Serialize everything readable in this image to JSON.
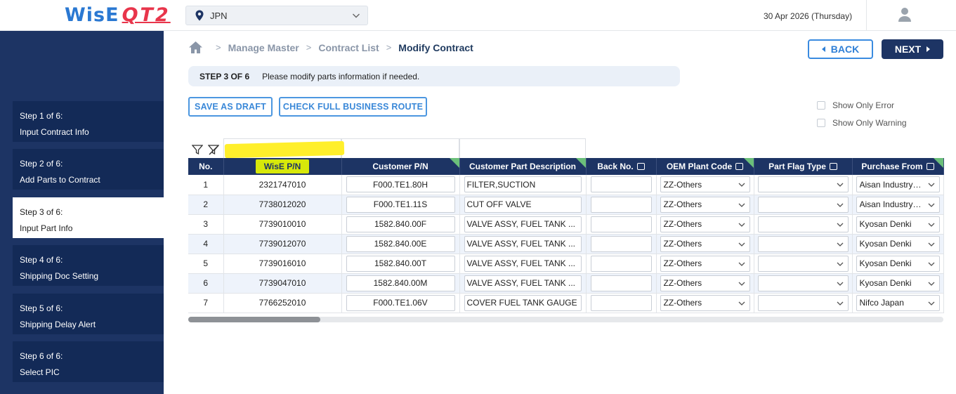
{
  "header": {
    "logo_main": "WisE",
    "logo_sub": "QT2",
    "country": "JPN",
    "date": "30 Apr 2026 (Thursday)"
  },
  "sidebar": {
    "steps": [
      {
        "num": "Step 1 of 6:",
        "label": "Input Contract Info"
      },
      {
        "num": "Step 2 of 6:",
        "label": "Add Parts to Contract"
      },
      {
        "num": "Step 3 of 6:",
        "label": "Input Part Info"
      },
      {
        "num": "Step 4 of 6:",
        "label": "Shipping Doc Setting"
      },
      {
        "num": "Step 5 of 6:",
        "label": "Shipping Delay Alert"
      },
      {
        "num": "Step 6 of 6:",
        "label": "Select PIC"
      }
    ],
    "active_index": 2
  },
  "breadcrumb": {
    "items": [
      "Manage Master",
      "Contract List",
      "Modify Contract"
    ]
  },
  "actions": {
    "back_label": "BACK",
    "next_label": "NEXT",
    "save_draft_label": "SAVE AS DRAFT",
    "check_route_label": "CHECK FULL BUSINESS ROUTE"
  },
  "stepbar": {
    "step": "STEP 3 OF 6",
    "message": "Please modify parts information if needed."
  },
  "filters_panel": {
    "show_only_error": "Show Only Error",
    "show_only_warning": "Show Only Warning"
  },
  "table": {
    "columns": {
      "no": "No.",
      "wise_pn": "WisE P/N",
      "customer_pn": "Customer P/N",
      "customer_desc": "Customer Part Description",
      "back_no": "Back No.",
      "oem_plant": "OEM Plant Code",
      "part_flag": "Part Flag Type",
      "purchase_from": "Purchase From"
    },
    "rows": [
      {
        "no": "1",
        "wise_pn": "2321747010",
        "customer_pn": "F000.TE1.80H",
        "desc": "FILTER,SUCTION",
        "back_no": "",
        "oem": "ZZ-Others",
        "flag": "",
        "purchase": "Aisan Industry Japan"
      },
      {
        "no": "2",
        "wise_pn": "7738012020",
        "customer_pn": "F000.TE1.11S",
        "desc": "CUT OFF VALVE",
        "back_no": "",
        "oem": "ZZ-Others",
        "flag": "",
        "purchase": "Aisan Industry Japan"
      },
      {
        "no": "3",
        "wise_pn": "7739010010",
        "customer_pn": "1582.840.00F",
        "desc": "VALVE ASSY, FUEL TANK ...",
        "back_no": "",
        "oem": "ZZ-Others",
        "flag": "",
        "purchase": "Kyosan Denki"
      },
      {
        "no": "4",
        "wise_pn": "7739012070",
        "customer_pn": "1582.840.00E",
        "desc": "VALVE ASSY, FUEL TANK ...",
        "back_no": "",
        "oem": "ZZ-Others",
        "flag": "",
        "purchase": "Kyosan Denki"
      },
      {
        "no": "5",
        "wise_pn": "7739016010",
        "customer_pn": "1582.840.00T",
        "desc": "VALVE ASSY, FUEL TANK ...",
        "back_no": "",
        "oem": "ZZ-Others",
        "flag": "",
        "purchase": "Kyosan Denki"
      },
      {
        "no": "6",
        "wise_pn": "7739047010",
        "customer_pn": "1582.840.00M",
        "desc": "VALVE ASSY, FUEL TANK ...",
        "back_no": "",
        "oem": "ZZ-Others",
        "flag": "",
        "purchase": "Kyosan Denki"
      },
      {
        "no": "7",
        "wise_pn": "7766252010",
        "customer_pn": "F000.TE1.06V",
        "desc": "COVER FUEL TANK GAUGE",
        "back_no": "",
        "oem": "ZZ-Others",
        "flag": "",
        "purchase": "Nifco Japan"
      }
    ]
  },
  "colors": {
    "navy": "#1d3464",
    "accent_blue": "#3a88d8",
    "highlight_yellow": "#ffef2b",
    "tag_green": "#6bbf7a"
  },
  "icons": [
    "map-pin-icon",
    "chevron-down-icon",
    "user-icon",
    "home-icon",
    "filter-icon",
    "clear-filter-icon",
    "comment-icon"
  ]
}
